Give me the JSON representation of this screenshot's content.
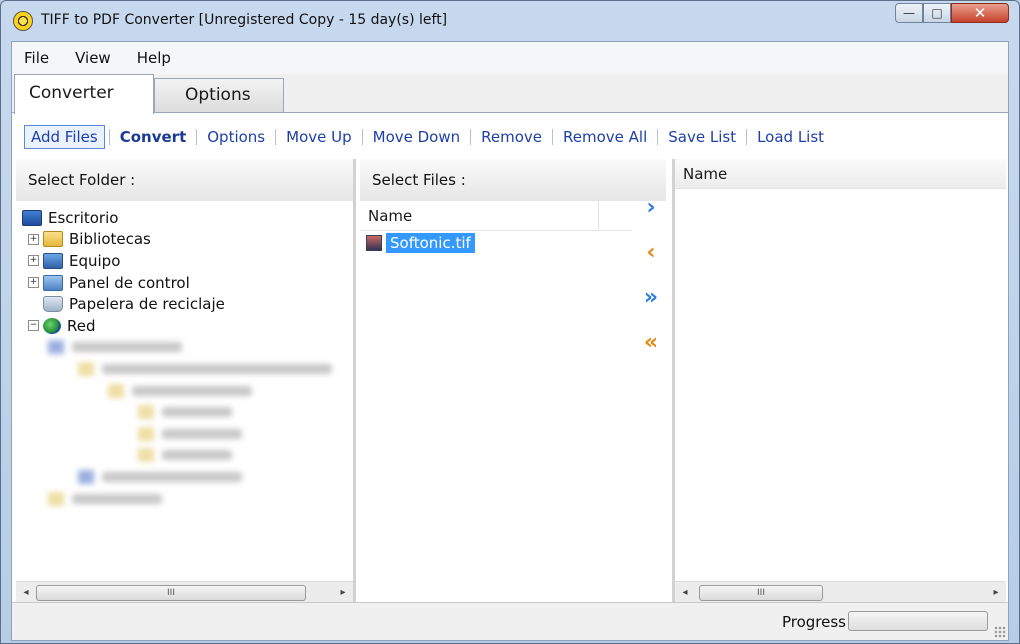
{
  "window": {
    "title": "TIFF to PDF Converter [Unregistered Copy - 15 day(s) left]",
    "buttons": {
      "minimize": "—",
      "maximize": "□",
      "close": "✕"
    }
  },
  "menu": {
    "items": [
      "File",
      "View",
      "Help"
    ]
  },
  "tabs": [
    {
      "label": "Converter",
      "active": true
    },
    {
      "label": "Options",
      "active": false
    }
  ],
  "toolbar": {
    "add_files": "Add Files",
    "convert": "Convert",
    "options": "Options",
    "move_up": "Move Up",
    "move_down": "Move Down",
    "remove": "Remove",
    "remove_all": "Remove All",
    "save_list": "Save List",
    "load_list": "Load List"
  },
  "folder_panel": {
    "header": "Select Folder :",
    "tree": [
      {
        "label": "Escritorio",
        "icon": "desktop-icon"
      },
      {
        "label": "Bibliotecas",
        "icon": "library-folder-icon",
        "expander": "+"
      },
      {
        "label": "Equipo",
        "icon": "computer-icon",
        "expander": "+"
      },
      {
        "label": "Panel de control",
        "icon": "control-panel-icon",
        "expander": "+"
      },
      {
        "label": "Papelera de reciclaje",
        "icon": "recycle-bin-icon"
      },
      {
        "label": "Red",
        "icon": "network-icon",
        "expander": "−"
      }
    ]
  },
  "files_panel": {
    "header": "Select Files :",
    "column": "Name",
    "files": [
      {
        "name": "Softonic.tif",
        "selected": true
      }
    ]
  },
  "transfer_buttons": {
    "add_one": "›",
    "remove_one": "‹",
    "add_all": "»",
    "remove_all": "«"
  },
  "output_panel": {
    "column": "Name"
  },
  "scrollbar": {
    "left_arrow": "◂",
    "right_arrow": "▸",
    "thumb_grip": "III"
  },
  "status": {
    "progress_label": "Progress",
    "progress_value": 0
  },
  "colors": {
    "link": "#1f3fa8",
    "selection": "#3399ff",
    "arrow_blue": "#2b7be6",
    "arrow_orange": "#e48a16"
  }
}
